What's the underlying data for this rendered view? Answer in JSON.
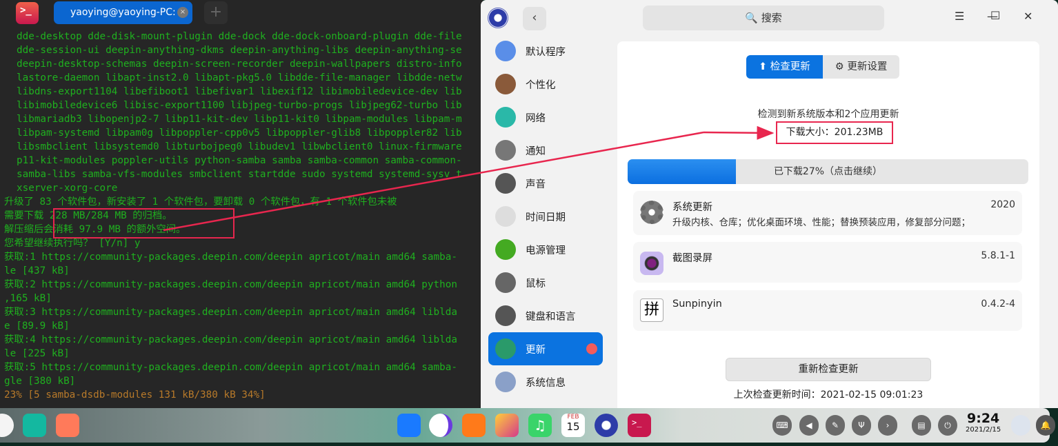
{
  "terminal": {
    "tab_title": "yaoying@yaoying-PC: ~",
    "close": "×",
    "new_tab": "+",
    "prompt_icon": ">_",
    "lines": [
      {
        "t": "dde-desktop dde-disk-mount-plugin dde-dock dde-dock-onboard-plugin dde-file",
        "c": "i"
      },
      {
        "t": "dde-session-ui deepin-anything-dkms deepin-anything-libs deepin-anything-se",
        "c": "i"
      },
      {
        "t": "deepin-desktop-schemas deepin-screen-recorder deepin-wallpapers distro-info",
        "c": "i"
      },
      {
        "t": "lastore-daemon libapt-inst2.0 libapt-pkg5.0 libdde-file-manager libdde-netw",
        "c": "i"
      },
      {
        "t": "libdns-export1104 libefiboot1 libefivar1 libexif12 libimobiledevice-dev lib",
        "c": "i"
      },
      {
        "t": "libimobiledevice6 libisc-export1100 libjpeg-turbo-progs libjpeg62-turbo lib",
        "c": "i"
      },
      {
        "t": "libmariadb3 libopenjp2-7 libp11-kit-dev libp11-kit0 libpam-modules libpam-m",
        "c": "i"
      },
      {
        "t": "libpam-systemd libpam0g libpoppler-cpp0v5 libpoppler-glib8 libpoppler82 lib",
        "c": "i"
      },
      {
        "t": "libsmbclient libsystemd0 libturbojpeg0 libudev1 libwbclient0 linux-firmware",
        "c": "i"
      },
      {
        "t": "p11-kit-modules poppler-utils python-samba samba samba-common samba-common-",
        "c": "i"
      },
      {
        "t": "samba-libs samba-vfs-modules smbclient startdde sudo systemd systemd-sysv t",
        "c": "i"
      },
      {
        "t": "xserver-xorg-core",
        "c": "i"
      },
      {
        "t": "升级了 83 个软件包，新安装了 1 个软件包，要卸载 0 个软件包，有 1 个软件包未被",
        "c": ""
      },
      {
        "t": "需要下载 228 MB/284 MB 的归档。",
        "c": ""
      },
      {
        "t": "解压缩后会消耗 97.9 MB 的额外空间。",
        "c": ""
      },
      {
        "t": "您希望继续执行吗？ [Y/n] y",
        "c": ""
      },
      {
        "t": "获取:1 https://community-packages.deepin.com/deepin apricot/main amd64 samba-",
        "c": ""
      },
      {
        "t": "le [437 kB]",
        "c": ""
      },
      {
        "t": "获取:2 https://community-packages.deepin.com/deepin apricot/main amd64 python",
        "c": ""
      },
      {
        "t": ",165 kB]",
        "c": ""
      },
      {
        "t": "获取:3 https://community-packages.deepin.com/deepin apricot/main amd64 liblda",
        "c": ""
      },
      {
        "t": "e [89.9 kB]",
        "c": ""
      },
      {
        "t": "获取:4 https://community-packages.deepin.com/deepin apricot/main amd64 liblda",
        "c": ""
      },
      {
        "t": "le [225 kB]",
        "c": ""
      },
      {
        "t": "获取:5 https://community-packages.deepin.com/deepin apricot/main amd64 samba-",
        "c": ""
      },
      {
        "t": "gle [380 kB]",
        "c": ""
      },
      {
        "t": "23% [5 samba-dsdb-modules 131 kB/380 kB 34%]",
        "c": "o"
      }
    ]
  },
  "settings": {
    "back": "‹",
    "search": "🔍 搜索",
    "menu": "☰",
    "min": "—",
    "max": "☐",
    "close": "✕",
    "sidebar": [
      {
        "label": "默认程序",
        "color": "#5a8ee8"
      },
      {
        "label": "个性化",
        "color": "#8a5a3a"
      },
      {
        "label": "网络",
        "color": "#2ab8a8"
      },
      {
        "label": "通知",
        "color": "#777"
      },
      {
        "label": "声音",
        "color": "#555"
      },
      {
        "label": "时间日期",
        "color": "#ddd"
      },
      {
        "label": "电源管理",
        "color": "#44aa22"
      },
      {
        "label": "鼠标",
        "color": "#666"
      },
      {
        "label": "键盘和语言",
        "color": "#555"
      },
      {
        "label": "更新",
        "color": "#2a9a6a"
      },
      {
        "label": "系统信息",
        "color": "#8aa0c8"
      }
    ],
    "selected": "更新",
    "tabs": {
      "check": "检查更新",
      "settings": "更新设置"
    },
    "found": "检测到新系统版本和2个应用更新",
    "download_size": "下载大小：201.23MB",
    "progress": {
      "percent": 27,
      "label": "已下载27%（点击继续）"
    },
    "updates": [
      {
        "name": "系统更新",
        "desc": "升级内核、仓库；优化桌面环境、性能；替换预装应用，修复部分问题；",
        "version": "2020"
      },
      {
        "name": "截图录屏",
        "desc": "",
        "version": "5.8.1-1"
      },
      {
        "name": "Sunpinyin",
        "desc": "",
        "version": "0.4.2-4",
        "icon_text": "拼"
      }
    ],
    "recheck": "重新检查更新",
    "last_check": "上次检查更新时间：2021-02-15 09:01:23"
  },
  "dock": {
    "time": "9:24",
    "date": "2021/2/15",
    "calendar_month": "FEB",
    "calendar_day": "15"
  },
  "colors": {
    "accent": "#0b73e0",
    "annotation": "#e8264e",
    "terminal_green": "#1fb01f"
  }
}
